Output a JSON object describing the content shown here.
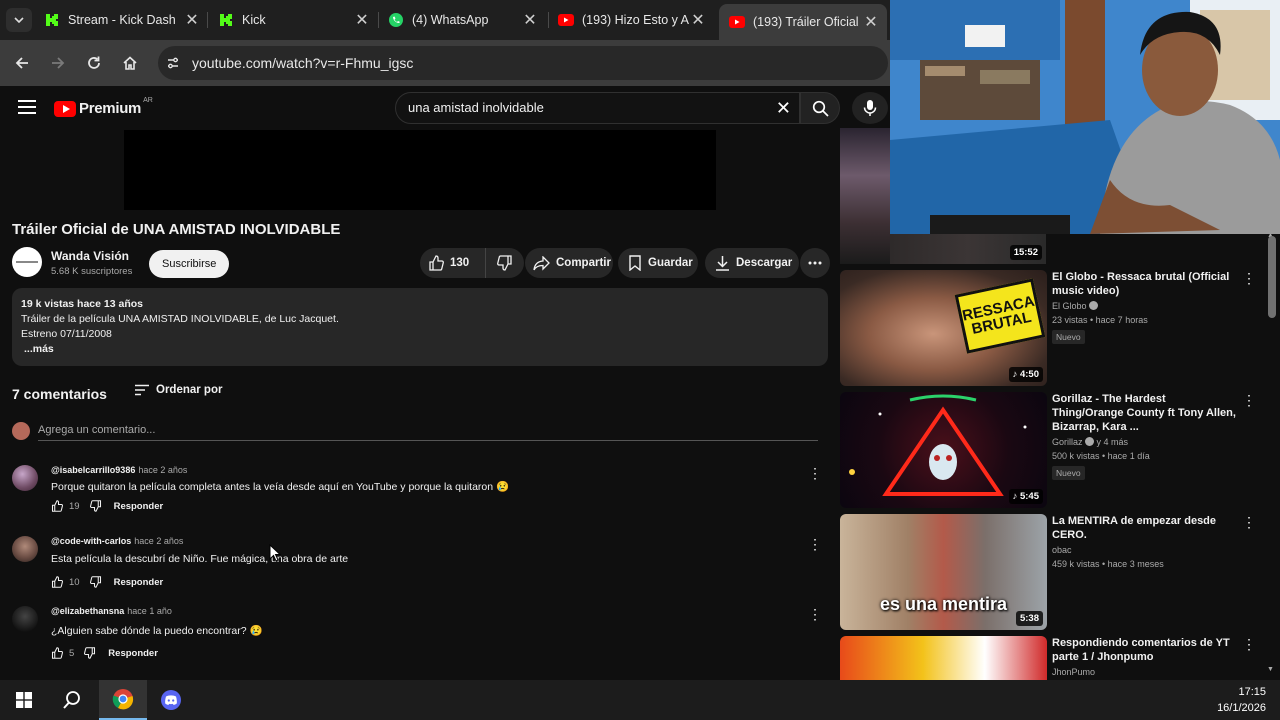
{
  "browser": {
    "tabs": [
      {
        "title": "Stream - Kick Dash",
        "favicon": "kick-icon"
      },
      {
        "title": "Kick",
        "favicon": "kick-icon"
      },
      {
        "title": "(4) WhatsApp",
        "favicon": "whatsapp-icon"
      },
      {
        "title": "(193) Hizo Esto y A",
        "favicon": "youtube-icon"
      },
      {
        "title": "(193) Tráiler Oficial",
        "favicon": "youtube-icon",
        "active": true
      }
    ],
    "close_glyph": "✕",
    "url": "youtube.com/watch?v=r-Fhmu_igsc"
  },
  "youtube": {
    "logo_text": "Premium",
    "country_code": "AR",
    "search_value": "una amistad inolvidable",
    "clear_glyph": "✕"
  },
  "video": {
    "title": "Tráiler Oficial de UNA AMISTAD INOLVIDABLE",
    "channel_name": "Wanda Visión",
    "channel_subs": "5.68 K suscriptores",
    "subscribe_label": "Suscribirse",
    "likes": "130",
    "share_label": "Compartir",
    "save_label": "Guardar",
    "download_label": "Descargar",
    "description": {
      "meta": "19 k vistas  hace 13 años",
      "line1": "Tráiler de la película UNA AMISTAD INOLVIDABLE, de Luc Jacquet.",
      "line2": "Estreno 07/11/2008",
      "more": "...más"
    }
  },
  "comments": {
    "count_label": "7 comentarios",
    "sort_label": "Ordenar por",
    "add_placeholder": "Agrega un comentario...",
    "reply_label": "Responder",
    "items": [
      {
        "author": "@isabelcarrillo9386",
        "time": "hace 2 años",
        "text": "Porque quitaron la película completa antes la veía desde aquí en YouTube y porque la quitaron 😢",
        "likes": "19"
      },
      {
        "author": "@code-with-carlos",
        "time": "hace 2 años",
        "text": "Esta película la descubrí de Niño. Fue mágica, una obra de arte",
        "likes": "10"
      },
      {
        "author": "@elizabethansna",
        "time": "hace 1 año",
        "text": "¿Alguien sabe dónde la puedo encontrar? 😢",
        "likes": "5"
      }
    ]
  },
  "sidebar": {
    "first_duration": "15:52",
    "items": [
      {
        "title": "El Globo - Ressaca brutal (Official music video)",
        "channel": "El Globo",
        "meta": "23 vistas • hace 7 horas",
        "badge": "Nuevo",
        "duration": "♪ 4:50",
        "thumb_text": "RESSACA BRUTAL"
      },
      {
        "title": "Gorillaz - The Hardest Thing/Orange County ft Tony Allen, Bizarrap, Kara ...",
        "channel": "Gorillaz",
        "channel_extra": "y 4 más",
        "meta": "500 k vistas • hace 1 día",
        "badge": "Nuevo",
        "duration": "♪ 5:45"
      },
      {
        "title": "La MENTIRA de empezar desde CERO.",
        "channel": "obac",
        "meta": "459 k vistas • hace 3 meses",
        "duration": "5:38",
        "thumb_text": "es una mentira"
      },
      {
        "title": "Respondiendo comentarios de YT parte 1 / Jhonpumo",
        "channel": "JhonPumo"
      }
    ]
  },
  "taskbar": {
    "time": "17:15",
    "date": "16/1/2026"
  }
}
